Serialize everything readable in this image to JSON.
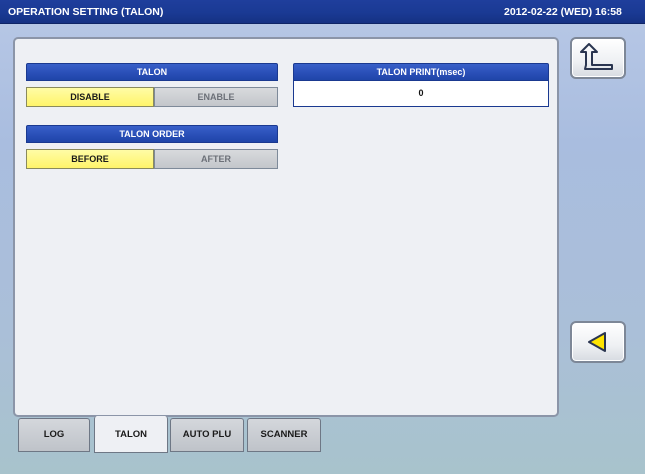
{
  "window": {
    "title": "OPERATION SETTING (TALON)",
    "datetime": "2012-02-22 (WED) 16:58"
  },
  "talon": {
    "header": "TALON",
    "options": [
      "DISABLE",
      "ENABLE"
    ],
    "selected": "DISABLE"
  },
  "talon_print": {
    "header": "TALON PRINT(msec)",
    "value": "0"
  },
  "talon_order": {
    "header": "TALON ORDER",
    "options": [
      "BEFORE",
      "AFTER"
    ],
    "selected": "BEFORE"
  },
  "side_buttons": {
    "back_icon": "return-arrow-icon",
    "prev_icon": "left-triangle-icon"
  },
  "tabs": [
    {
      "label": "LOG"
    },
    {
      "label": "TALON"
    },
    {
      "label": "AUTO PLU"
    },
    {
      "label": "SCANNER"
    }
  ],
  "active_tab": "TALON"
}
